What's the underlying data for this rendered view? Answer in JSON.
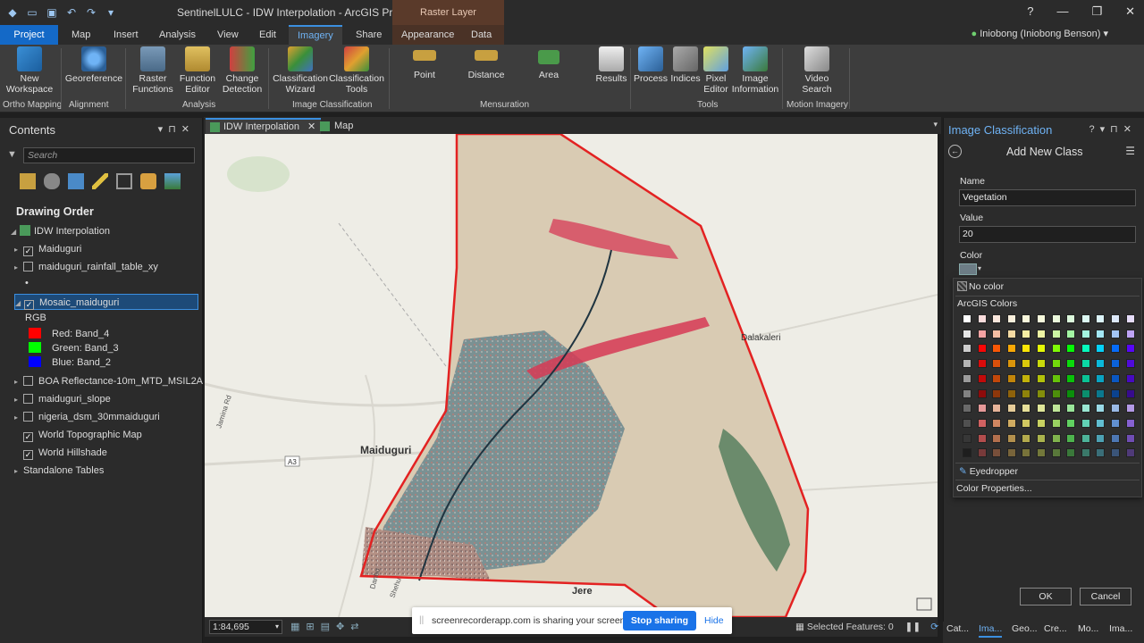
{
  "window": {
    "title": "SentinelLULC - IDW Interpolation - ArcGIS Pro",
    "context_tab_group": "Raster Layer",
    "help": "?",
    "minimize": "—",
    "restore": "❐",
    "close": "✕"
  },
  "tabs": [
    "Project",
    "Map",
    "Insert",
    "Analysis",
    "View",
    "Edit",
    "Imagery",
    "Share",
    "Appearance",
    "Data"
  ],
  "active_tab": "Imagery",
  "user": "Iniobong (Iniobong Benson)",
  "ribbon": {
    "buttons": {
      "new_workspace": "New\nWorkspace",
      "georeference": "Georeference",
      "raster_functions": "Raster\nFunctions",
      "function_editor": "Function\nEditor",
      "change_detection": "Change\nDetection",
      "classification_wizard": "Classification\nWizard",
      "classification_tools": "Classification\nTools",
      "point": "Point",
      "distance": "Distance",
      "area": "Area",
      "results": "Results",
      "process": "Process",
      "indices": "Indices",
      "pixel_editor": "Pixel\nEditor",
      "image_information": "Image\nInformation",
      "video_search": "Video\nSearch"
    },
    "groups": {
      "ortho": "Ortho Mapping",
      "alignment": "Alignment",
      "analysis": "Analysis",
      "image_classification": "Image Classification",
      "mensuration": "Mensuration",
      "tools": "Tools",
      "motion": "Motion Imagery"
    }
  },
  "contents": {
    "title": "Contents",
    "search_placeholder": "Search",
    "drawing_order": "Drawing Order",
    "layers": [
      {
        "label": "IDW Interpolation",
        "checked": null
      },
      {
        "label": "Maiduguri",
        "checked": true
      },
      {
        "label": "maiduguri_rainfall_table_xy",
        "checked": false
      },
      {
        "label": "•",
        "checked": null
      },
      {
        "label": "Mosaic_maiduguri",
        "checked": true
      },
      {
        "label": "RGB",
        "checked": null
      },
      {
        "label": "Red:   Band_4",
        "checked": null,
        "color": "#ff0000"
      },
      {
        "label": "Green:  Band_3",
        "checked": null,
        "color": "#00ff00"
      },
      {
        "label": "Blue:  Band_2",
        "checked": null,
        "color": "#0000ff"
      },
      {
        "label": "BOA Reflectance-10m_MTD_MSIL2A",
        "checked": false
      },
      {
        "label": "maiduguri_slope",
        "checked": false
      },
      {
        "label": "nigeria_dsm_30mmaiduguri",
        "checked": false
      },
      {
        "label": "World Topographic Map",
        "checked": true
      },
      {
        "label": "World Hillshade",
        "checked": true
      },
      {
        "label": "Standalone Tables",
        "checked": null
      }
    ]
  },
  "map_tabs": [
    "IDW Interpolation",
    "Map"
  ],
  "map": {
    "labels": {
      "maiduguri": "Maiduguri",
      "jere": "Jere",
      "dalakaleri": "Dalakaleri",
      "jamina_rd": "Jamina Rd",
      "a3": "A3",
      "danbo": "Danbo",
      "shehu": "Shehu"
    },
    "scale": "1:84,695",
    "selected_features": "Selected Features: 0"
  },
  "share_bar": {
    "text": "screenrecorderapp.com is sharing your screen.",
    "stop": "Stop sharing",
    "hide": "Hide"
  },
  "image_classification": {
    "title": "Image Classification",
    "subtitle": "Add New Class",
    "name_label": "Name",
    "name_value": "Vegetation",
    "value_label": "Value",
    "value_value": "20",
    "color_label": "Color",
    "selected_color": "#6d7d86",
    "picker": {
      "no_color": "No color",
      "group_title": "ArcGIS Colors",
      "eyedropper": "Eyedropper",
      "color_properties": "Color Properties..."
    },
    "ok": "OK",
    "cancel": "Cancel"
  },
  "bottom_tabs": [
    "Cat...",
    "Ima...",
    "Geo...",
    "Cre...",
    "Mo...",
    "Ima..."
  ]
}
